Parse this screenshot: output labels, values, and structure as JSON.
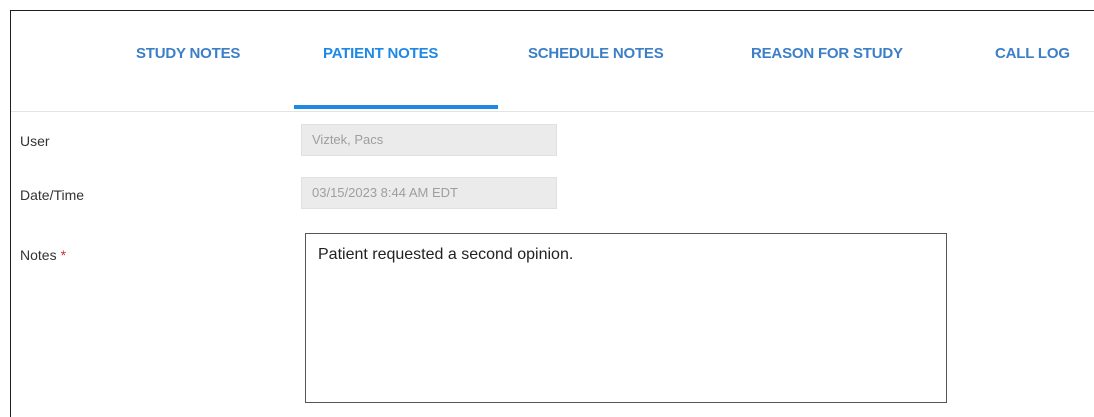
{
  "tabs": {
    "items": [
      {
        "label": "STUDY NOTES",
        "active": false
      },
      {
        "label": "PATIENT NOTES",
        "active": true
      },
      {
        "label": "SCHEDULE NOTES",
        "active": false
      },
      {
        "label": "REASON FOR STUDY",
        "active": false
      },
      {
        "label": "CALL LOG",
        "active": false
      }
    ]
  },
  "form": {
    "user": {
      "label": "User",
      "value": "Viztek, Pacs"
    },
    "datetime": {
      "label": "Date/Time",
      "value": "03/15/2023 8:44 AM EDT"
    },
    "notes": {
      "label": "Notes",
      "required_marker": "*",
      "value": "Patient requested a second opinion."
    }
  },
  "colors": {
    "tab_text": "#3d7fc7",
    "tab_active": "#1e88e5",
    "required": "#d32f2f",
    "readonly_bg": "#ebebeb"
  }
}
